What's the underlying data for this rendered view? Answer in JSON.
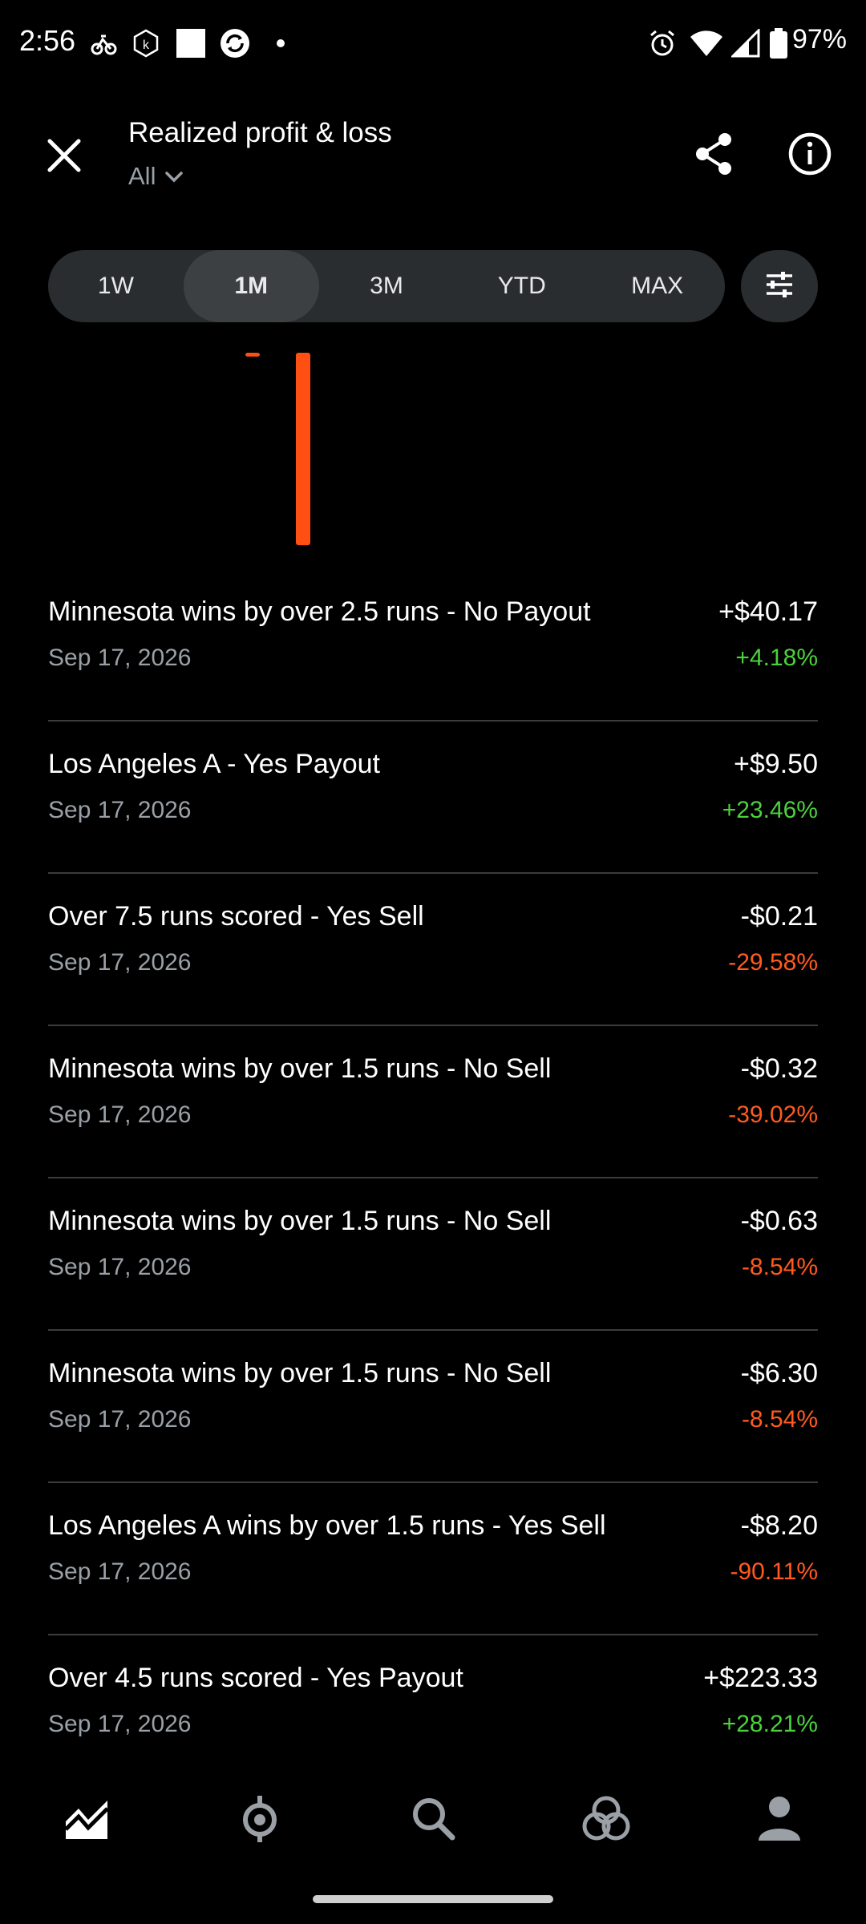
{
  "status_bar": {
    "time": "2:56",
    "battery": "97%",
    "icons": [
      "bike-icon",
      "k-badge-icon",
      "white-square-icon",
      "sync-icon",
      "dot-icon",
      "alarm-icon",
      "wifi-icon",
      "signal-icon",
      "battery-icon"
    ]
  },
  "header": {
    "title": "Realized profit & loss",
    "filter": "All",
    "icons": [
      "close-icon",
      "chevron-down-icon",
      "share-icon",
      "info-icon"
    ]
  },
  "ranges": {
    "items": [
      "1W",
      "1M",
      "3M",
      "YTD",
      "MAX"
    ],
    "active": "1M",
    "filter_icon": "sliders-icon"
  },
  "colors": {
    "positive": "#4cd13d",
    "negative": "#ff5a1f",
    "bar": "#ff4f12"
  },
  "chart_data": {
    "type": "bar",
    "categories": [
      "",
      ""
    ],
    "values": [
      -0.02,
      -1
    ],
    "title": "",
    "xlabel": "",
    "ylabel": "",
    "note": ""
  },
  "trades": [
    {
      "name": "Minnesota wins by over 2.5 runs - No Payout",
      "date": "Sep 17, 2026",
      "amount": "+$40.17",
      "percent": "+4.18%",
      "sign": "pos"
    },
    {
      "name": "Los Angeles A - Yes Payout",
      "date": "Sep 17, 2026",
      "amount": "+$9.50",
      "percent": "+23.46%",
      "sign": "pos"
    },
    {
      "name": "Over 7.5 runs scored - Yes Sell",
      "date": "Sep 17, 2026",
      "amount": "-$0.21",
      "percent": "-29.58%",
      "sign": "neg"
    },
    {
      "name": "Minnesota wins by over 1.5 runs - No Sell",
      "date": "Sep 17, 2026",
      "amount": "-$0.32",
      "percent": "-39.02%",
      "sign": "neg"
    },
    {
      "name": "Minnesota wins by over 1.5 runs - No Sell",
      "date": "Sep 17, 2026",
      "amount": "-$0.63",
      "percent": "-8.54%",
      "sign": "neg"
    },
    {
      "name": "Minnesota wins by over 1.5 runs - No Sell",
      "date": "Sep 17, 2026",
      "amount": "-$6.30",
      "percent": "-8.54%",
      "sign": "neg"
    },
    {
      "name": "Los Angeles A wins by over 1.5 runs - Yes Sell",
      "date": "Sep 17, 2026",
      "amount": "-$8.20",
      "percent": "-90.11%",
      "sign": "neg"
    },
    {
      "name": "Over 4.5 runs scored - Yes Payout",
      "date": "Sep 17, 2026",
      "amount": "+$223.33",
      "percent": "+28.21%",
      "sign": "pos"
    }
  ],
  "nav": {
    "items": [
      {
        "icon": "chart-icon"
      },
      {
        "icon": "sports-icon"
      },
      {
        "icon": "search-icon"
      },
      {
        "icon": "markets-icon"
      },
      {
        "icon": "profile-icon"
      }
    ]
  }
}
